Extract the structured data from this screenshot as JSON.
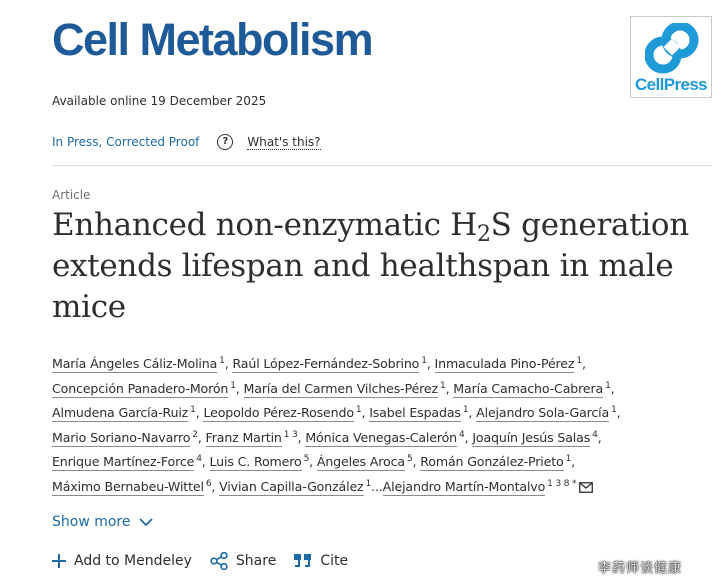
{
  "header": {
    "journal_title": "Cell Metabolism",
    "publisher_logo_text": "CellPress",
    "brand_color": "#1f5a98",
    "logo_color": "#1e9ad6"
  },
  "availability": "Available online 19 December 2025",
  "status": {
    "label": "In Press, Corrected Proof",
    "help_icon": "question-mark-circle-icon",
    "whats_this": "What's this?"
  },
  "article": {
    "type": "Article",
    "title_part1": "Enhanced non-enzymatic H",
    "title_sub": "2",
    "title_part2": "S generation extends lifespan and healthspan in male mice"
  },
  "authors": [
    {
      "name": "María Ángeles Cáliz-Molina",
      "aff": "1"
    },
    {
      "name": "Raúl López-Fernández-Sobrino",
      "aff": "1"
    },
    {
      "name": "Inmaculada Pino-Pérez",
      "aff": "1"
    },
    {
      "name": "Concepción Panadero-Morón",
      "aff": "1"
    },
    {
      "name": "María del Carmen Vilches-Pérez",
      "aff": "1"
    },
    {
      "name": "María Camacho-Cabrera",
      "aff": "1"
    },
    {
      "name": "Almudena García-Ruiz",
      "aff": "1"
    },
    {
      "name": "Leopoldo Pérez-Rosendo",
      "aff": "1"
    },
    {
      "name": "Isabel Espadas",
      "aff": "1"
    },
    {
      "name": "Alejandro Sola-García",
      "aff": "1"
    },
    {
      "name": "Mario Soriano-Navarro",
      "aff": "2"
    },
    {
      "name": "Franz Martin",
      "aff": "1 3"
    },
    {
      "name": "Mónica Venegas-Calerón",
      "aff": "4"
    },
    {
      "name": "Joaquín Jesús Salas",
      "aff": "4"
    },
    {
      "name": "Enrique Martínez-Force",
      "aff": "4"
    },
    {
      "name": "Luis C. Romero",
      "aff": "5"
    },
    {
      "name": "Ángeles Aroca",
      "aff": "5"
    },
    {
      "name": "Román González-Prieto",
      "aff": "1"
    },
    {
      "name": "Máximo Bernabeu-Wittel",
      "aff": "6"
    },
    {
      "name": "Vivian Capilla-González",
      "aff": "1"
    },
    {
      "name": "Alejandro Martín-Montalvo",
      "aff": "1 3 8 *"
    }
  ],
  "ellipsis": "...",
  "show_more": "Show more",
  "actions": {
    "mendeley": "Add to Mendeley",
    "share": "Share",
    "cite": "Cite"
  },
  "watermark": "李药师谈健康"
}
